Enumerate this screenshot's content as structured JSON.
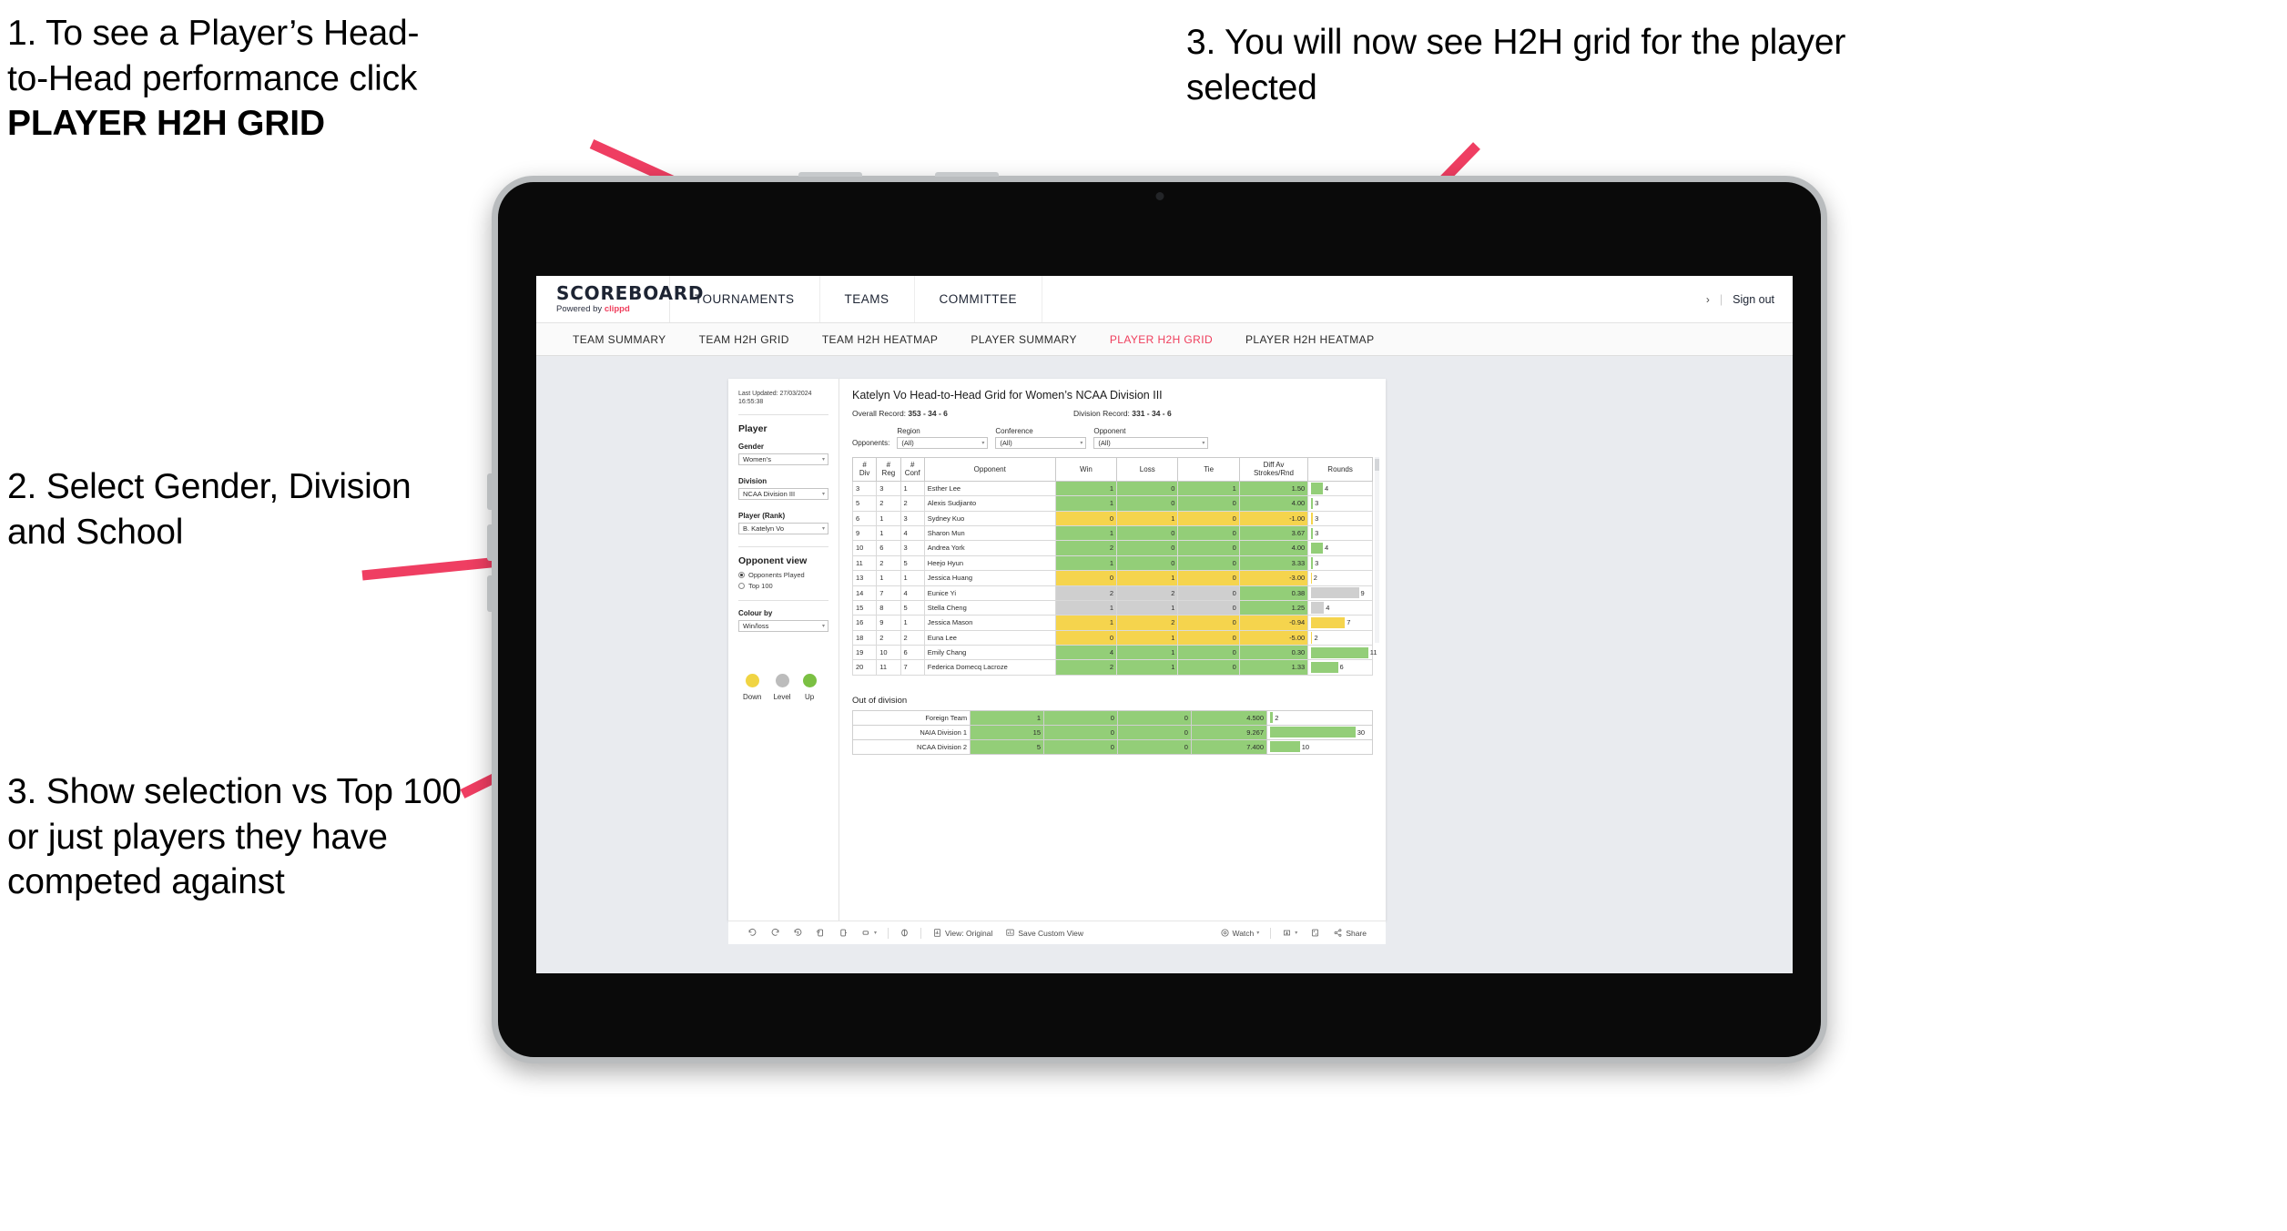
{
  "annotations": [
    {
      "id": "anno-1",
      "lines": [
        "1. To see a Player’s Head-",
        "to-Head performance click "
      ],
      "bold": "PLAYER H2H GRID"
    },
    {
      "id": "anno-2",
      "text": "2. Select Gender, Division and School"
    },
    {
      "id": "anno-3",
      "text": "3. Show selection vs Top 100 or just players they have competed against"
    },
    {
      "id": "anno-4",
      "text": "3. You will now see H2H grid for the player selected"
    }
  ],
  "brand": {
    "name": "SCOREBOARD",
    "powered_prefix": "Powered by ",
    "powered_accent": "clippd",
    "accent_color": "#ef3e5c"
  },
  "top_nav": [
    {
      "label": "TOURNAMENTS"
    },
    {
      "label": "TEAMS"
    },
    {
      "label": "COMMITTEE"
    }
  ],
  "top_right": {
    "chevron": "›",
    "separator": "|",
    "sign_out": "Sign out"
  },
  "sub_nav": [
    {
      "label": "TEAM SUMMARY",
      "active": false
    },
    {
      "label": "TEAM H2H GRID",
      "active": false
    },
    {
      "label": "TEAM H2H HEATMAP",
      "active": false
    },
    {
      "label": "PLAYER SUMMARY",
      "active": false
    },
    {
      "label": "PLAYER H2H GRID",
      "active": true
    },
    {
      "label": "PLAYER H2H HEATMAP",
      "active": false
    }
  ],
  "filter_pane": {
    "last_updated": "Last Updated: 27/03/2024 16:55:38",
    "player_heading": "Player",
    "gender": {
      "label": "Gender",
      "value": "Women’s"
    },
    "division": {
      "label": "Division",
      "value": "NCAA Division III"
    },
    "player_rank": {
      "label": "Player (Rank)",
      "value": "B. Katelyn Vo"
    },
    "opponent_view": {
      "heading": "Opponent view",
      "options": [
        {
          "label": "Opponents Played",
          "selected": true
        },
        {
          "label": "Top 100",
          "selected": false
        }
      ]
    },
    "colour_by": {
      "label": "Colour by",
      "value": "Win/loss"
    },
    "legend": [
      {
        "label": "Down",
        "color": "#f0d443"
      },
      {
        "label": "Level",
        "color": "#bcbcbc"
      },
      {
        "label": "Up",
        "color": "#7bc043"
      }
    ]
  },
  "content": {
    "title": "Katelyn Vo Head-to-Head Grid for Women’s NCAA Division III",
    "overall_record_label": "Overall Record: ",
    "overall_record_value": "353 -  34 - 6",
    "division_record_label": "Division Record: ",
    "division_record_value": "331 -  34 - 6",
    "opponents_label": "Opponents:",
    "opponent_filters": [
      {
        "label": "Region",
        "value": "(All)"
      },
      {
        "label": "Conference",
        "value": "(All)"
      },
      {
        "label": "Opponent",
        "value": "(All)"
      }
    ],
    "out_of_division_title": "Out of division"
  },
  "chart_data": {
    "type": "table",
    "title": "Katelyn Vo Head-to-Head Grid for Women’s NCAA Division III",
    "columns": [
      "# Div",
      "# Reg",
      "# Conf",
      "Opponent",
      "Win",
      "Loss",
      "Tie",
      "Diff Av Strokes/Rnd",
      "Rounds"
    ],
    "column_headers_two_line": [
      [
        "#",
        "Div"
      ],
      [
        "#",
        "Reg"
      ],
      [
        "#",
        "Conf"
      ],
      [
        "Opponent",
        ""
      ],
      [
        "Win",
        ""
      ],
      [
        "Loss",
        ""
      ],
      [
        "Tie",
        ""
      ],
      [
        "Diff Av",
        "Strokes/Rnd"
      ],
      [
        "Rounds",
        ""
      ]
    ],
    "rows": [
      {
        "div": "3",
        "reg": "3",
        "conf": "1",
        "opponent": "Esther Lee",
        "win": "1",
        "loss": "0",
        "tie": "1",
        "diff": "1.50",
        "rounds": "4",
        "color": "g",
        "bar_pct": 20
      },
      {
        "div": "5",
        "reg": "2",
        "conf": "2",
        "opponent": "Alexis Sudjianto",
        "win": "1",
        "loss": "0",
        "tie": "0",
        "diff": "4.00",
        "rounds": "3",
        "color": "g",
        "bar_pct": 3
      },
      {
        "div": "6",
        "reg": "1",
        "conf": "3",
        "opponent": "Sydney Kuo",
        "win": "0",
        "loss": "1",
        "tie": "0",
        "diff": "-1.00",
        "rounds": "3",
        "color": "y",
        "bar_pct": 3
      },
      {
        "div": "9",
        "reg": "1",
        "conf": "4",
        "opponent": "Sharon Mun",
        "win": "1",
        "loss": "0",
        "tie": "0",
        "diff": "3.67",
        "rounds": "3",
        "color": "g",
        "bar_pct": 3
      },
      {
        "div": "10",
        "reg": "6",
        "conf": "3",
        "opponent": "Andrea York",
        "win": "2",
        "loss": "0",
        "tie": "0",
        "diff": "4.00",
        "rounds": "4",
        "color": "g",
        "bar_pct": 20
      },
      {
        "div": "11",
        "reg": "2",
        "conf": "5",
        "opponent": "Heejo Hyun",
        "win": "1",
        "loss": "0",
        "tie": "0",
        "diff": "3.33",
        "rounds": "3",
        "color": "g",
        "bar_pct": 3
      },
      {
        "div": "13",
        "reg": "1",
        "conf": "1",
        "opponent": "Jessica Huang",
        "win": "0",
        "loss": "1",
        "tie": "0",
        "diff": "-3.00",
        "rounds": "2",
        "color": "y",
        "bar_pct": 1
      },
      {
        "div": "14",
        "reg": "7",
        "conf": "4",
        "opponent": "Eunice Yi",
        "win": "2",
        "loss": "2",
        "tie": "0",
        "diff": "0.38",
        "rounds": "9",
        "color": "n",
        "bar_pct": 82,
        "diff_color": "g"
      },
      {
        "div": "15",
        "reg": "8",
        "conf": "5",
        "opponent": "Stella Cheng",
        "win": "1",
        "loss": "1",
        "tie": "0",
        "diff": "1.25",
        "rounds": "4",
        "color": "n",
        "bar_pct": 22,
        "diff_color": "g"
      },
      {
        "div": "16",
        "reg": "9",
        "conf": "1",
        "opponent": "Jessica Mason",
        "win": "1",
        "loss": "2",
        "tie": "0",
        "diff": "-0.94",
        "rounds": "7",
        "color": "y",
        "bar_pct": 58
      },
      {
        "div": "18",
        "reg": "2",
        "conf": "2",
        "opponent": "Euna Lee",
        "win": "0",
        "loss": "1",
        "tie": "0",
        "diff": "-5.00",
        "rounds": "2",
        "color": "y",
        "bar_pct": 2
      },
      {
        "div": "19",
        "reg": "10",
        "conf": "6",
        "opponent": "Emily Chang",
        "win": "4",
        "loss": "1",
        "tie": "0",
        "diff": "0.30",
        "rounds": "11",
        "color": "g",
        "bar_pct": 98
      },
      {
        "div": "20",
        "reg": "11",
        "conf": "7",
        "opponent": "Federica Domecq Lacroze",
        "win": "2",
        "loss": "1",
        "tie": "0",
        "diff": "1.33",
        "rounds": "6",
        "color": "g",
        "bar_pct": 46
      }
    ],
    "out_of_division": {
      "title": "Out of division",
      "rows": [
        {
          "name": "Foreign Team",
          "win": "1",
          "loss": "0",
          "tie": "0",
          "diff": "4.500",
          "rounds": "2",
          "color": "g",
          "bar_pct": 3
        },
        {
          "name": "NAIA Division 1",
          "win": "15",
          "loss": "0",
          "tie": "0",
          "diff": "9.267",
          "rounds": "30",
          "color": "g",
          "bar_pct": 86
        },
        {
          "name": "NCAA Division 2",
          "win": "5",
          "loss": "0",
          "tie": "0",
          "diff": "7.400",
          "rounds": "10",
          "color": "g",
          "bar_pct": 30
        }
      ]
    },
    "legend": [
      {
        "label": "Down",
        "color": "#f0d443"
      },
      {
        "label": "Level",
        "color": "#bcbcbc"
      },
      {
        "label": "Up",
        "color": "#7bc043"
      }
    ],
    "colors": {
      "up": "#93ce78",
      "down": "#f5d44d",
      "level": "#cfcfcf"
    }
  },
  "toolbar": {
    "undo": "undo-icon",
    "redo": "redo-icon",
    "revert": "revert-icon",
    "refresh": "refresh-icon",
    "pause": "pause-icon",
    "view_original": "View: Original",
    "save_custom_view": "Save Custom View",
    "watch": "Watch",
    "share": "Share"
  }
}
